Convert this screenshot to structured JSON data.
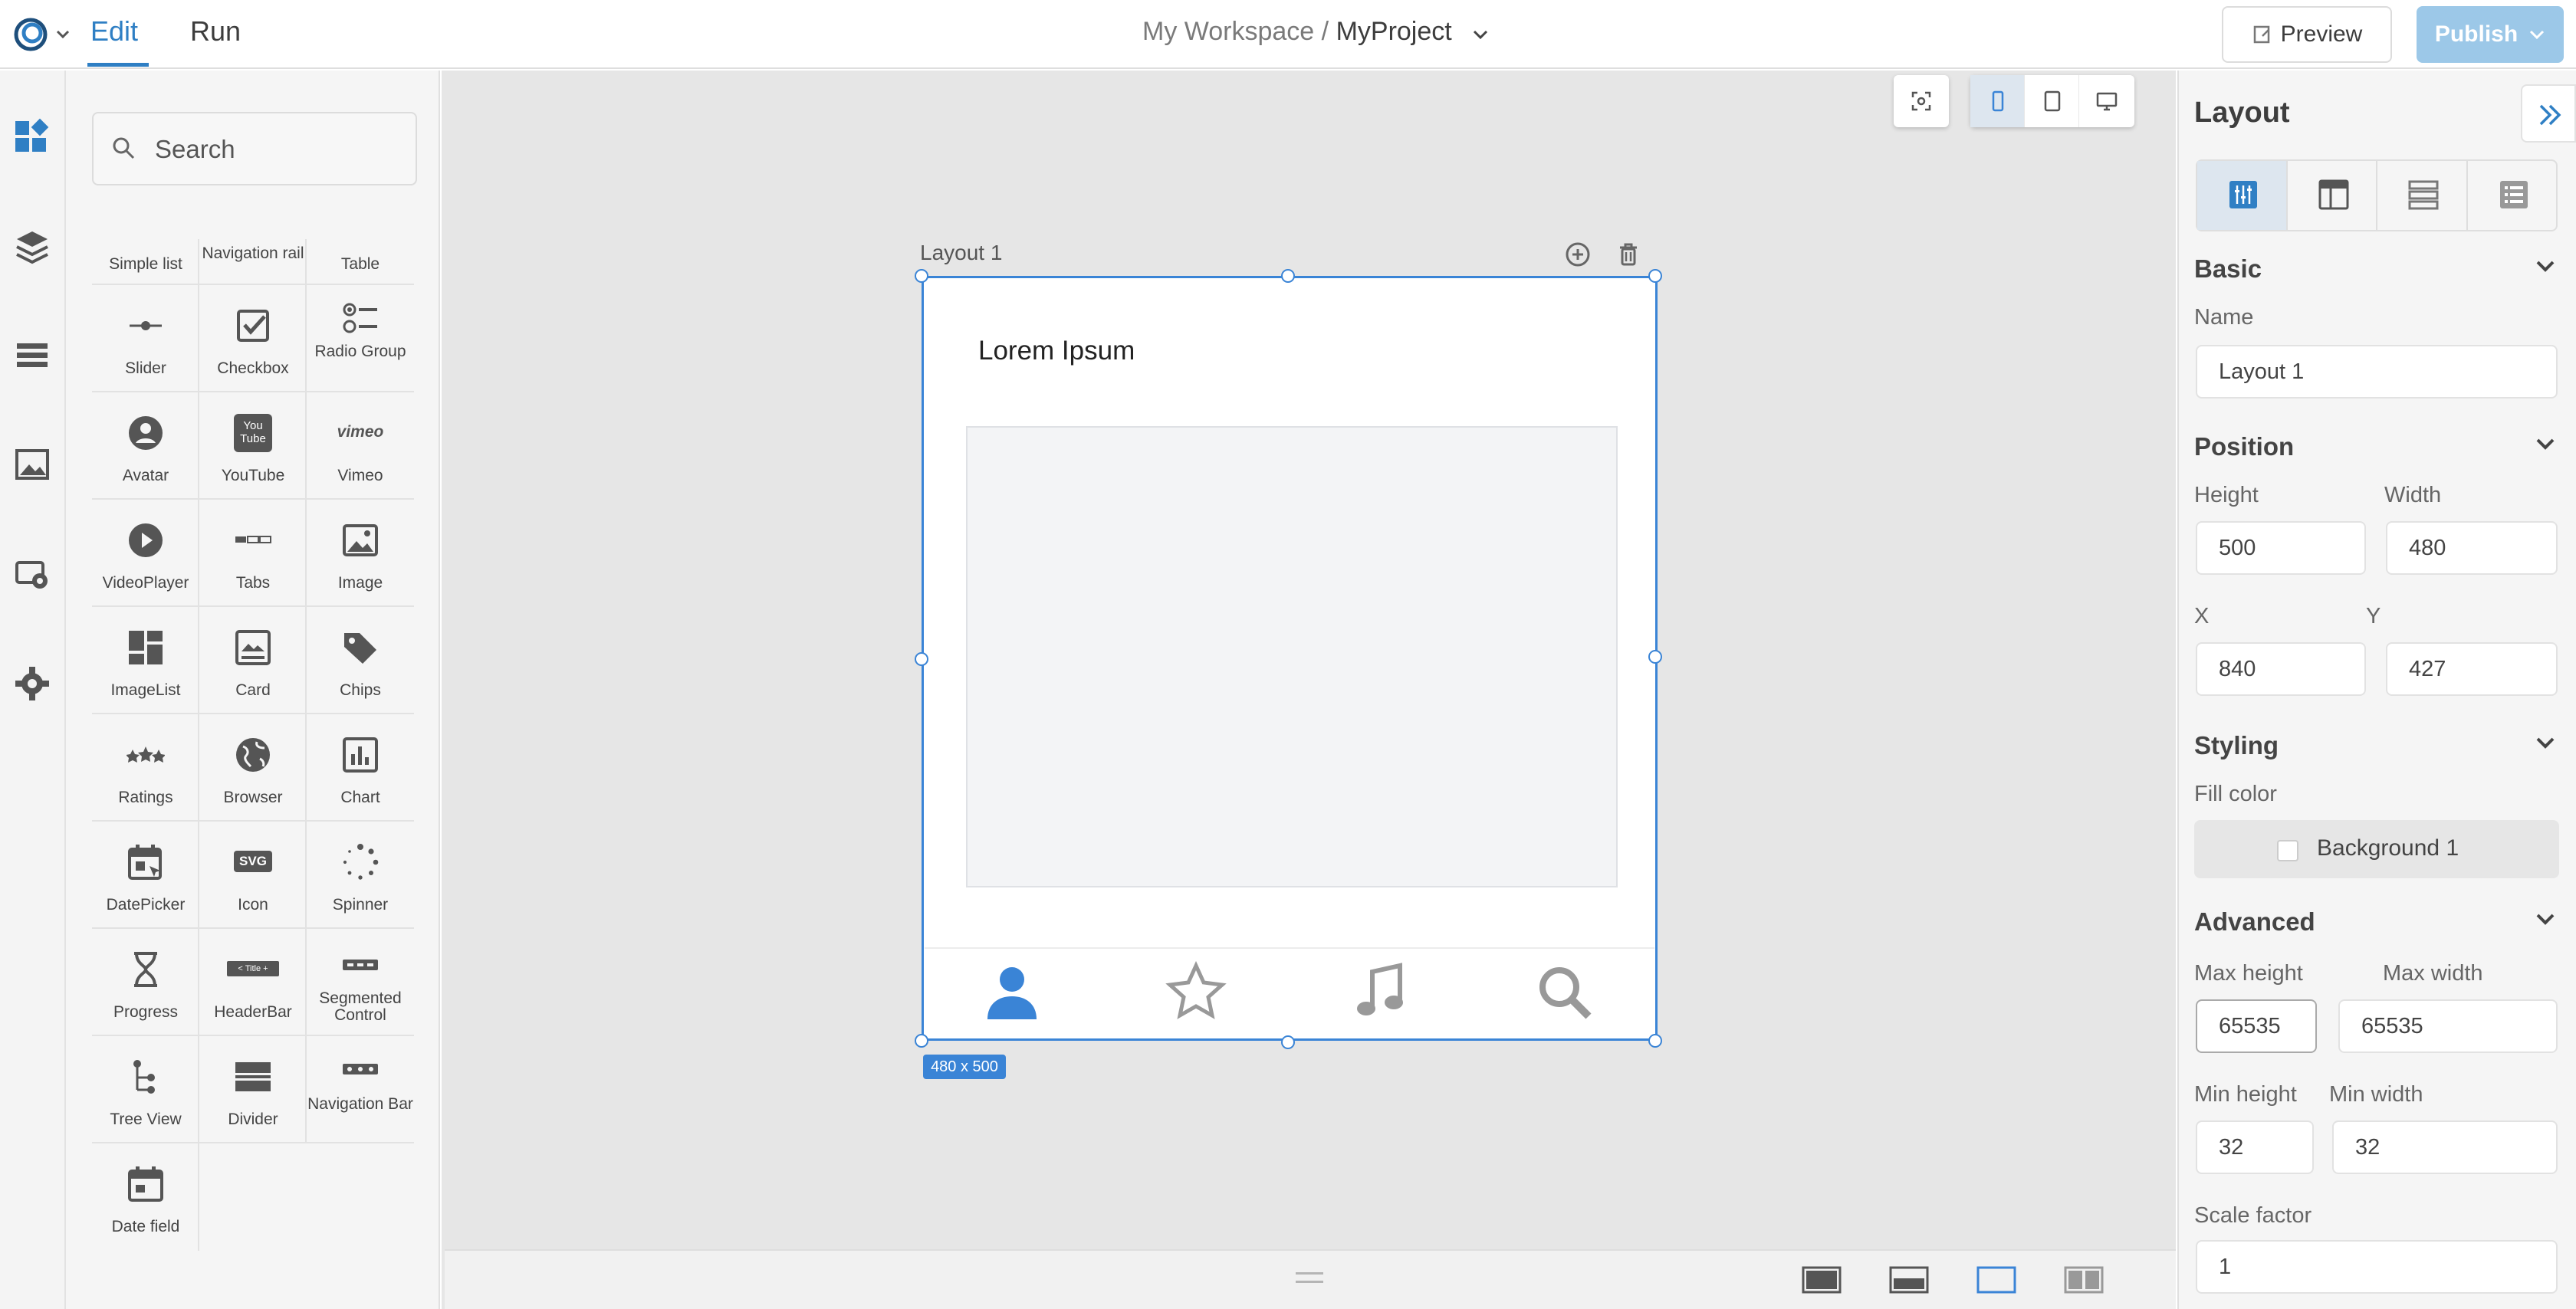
{
  "topbar": {
    "tab_edit": "Edit",
    "tab_run": "Run",
    "workspace": "My Workspace",
    "separator": "/",
    "project": "MyProject",
    "preview_label": "Preview",
    "publish_label": "Publish"
  },
  "rail": {
    "icons": [
      "widgets-icon",
      "layers-icon",
      "list-icon",
      "image-icon",
      "themes-icon",
      "settings-icon"
    ]
  },
  "components": {
    "search_placeholder": "Search",
    "items": [
      "Simple list",
      "Navigation rail",
      "Table",
      "Slider",
      "Checkbox",
      "Radio Group",
      "Avatar",
      "YouTube",
      "Vimeo",
      "VideoPlayer",
      "Tabs",
      "Image",
      "ImageList",
      "Card",
      "Chips",
      "Ratings",
      "Browser",
      "Chart",
      "DatePicker",
      "Icon",
      "Spinner",
      "Progress",
      "HeaderBar",
      "Segmented Control",
      "Tree View",
      "Divider",
      "Navigation Bar",
      "Date field"
    ],
    "icon_texts": {
      "youtube": "You Tube",
      "vimeo": "vimeo",
      "svg": "SVG",
      "headerbar": "< Title +"
    }
  },
  "canvas": {
    "layout_title": "Layout 1",
    "heading": "Lorem Ipsum",
    "size_badge": "480 x 500",
    "accent": "#3a84d6",
    "nav_icons": [
      "person-icon",
      "star-icon",
      "music-icon",
      "search-icon"
    ]
  },
  "props": {
    "title": "Layout",
    "basic": {
      "section": "Basic",
      "name_label": "Name",
      "name_value": "Layout 1"
    },
    "position": {
      "section": "Position",
      "height_label": "Height",
      "height_value": "500",
      "width_label": "Width",
      "width_value": "480",
      "x_label": "X",
      "x_value": "840",
      "y_label": "Y",
      "y_value": "427"
    },
    "styling": {
      "section": "Styling",
      "fill_label": "Fill color",
      "fill_value": "Background 1"
    },
    "advanced": {
      "section": "Advanced",
      "max_height_label": "Max height",
      "max_height_value": "65535",
      "max_width_label": "Max width",
      "max_width_value": "65535",
      "min_height_label": "Min height",
      "min_height_value": "32",
      "min_width_label": "Min width",
      "min_width_value": "32",
      "scale_label": "Scale factor",
      "scale_value": "1"
    }
  }
}
